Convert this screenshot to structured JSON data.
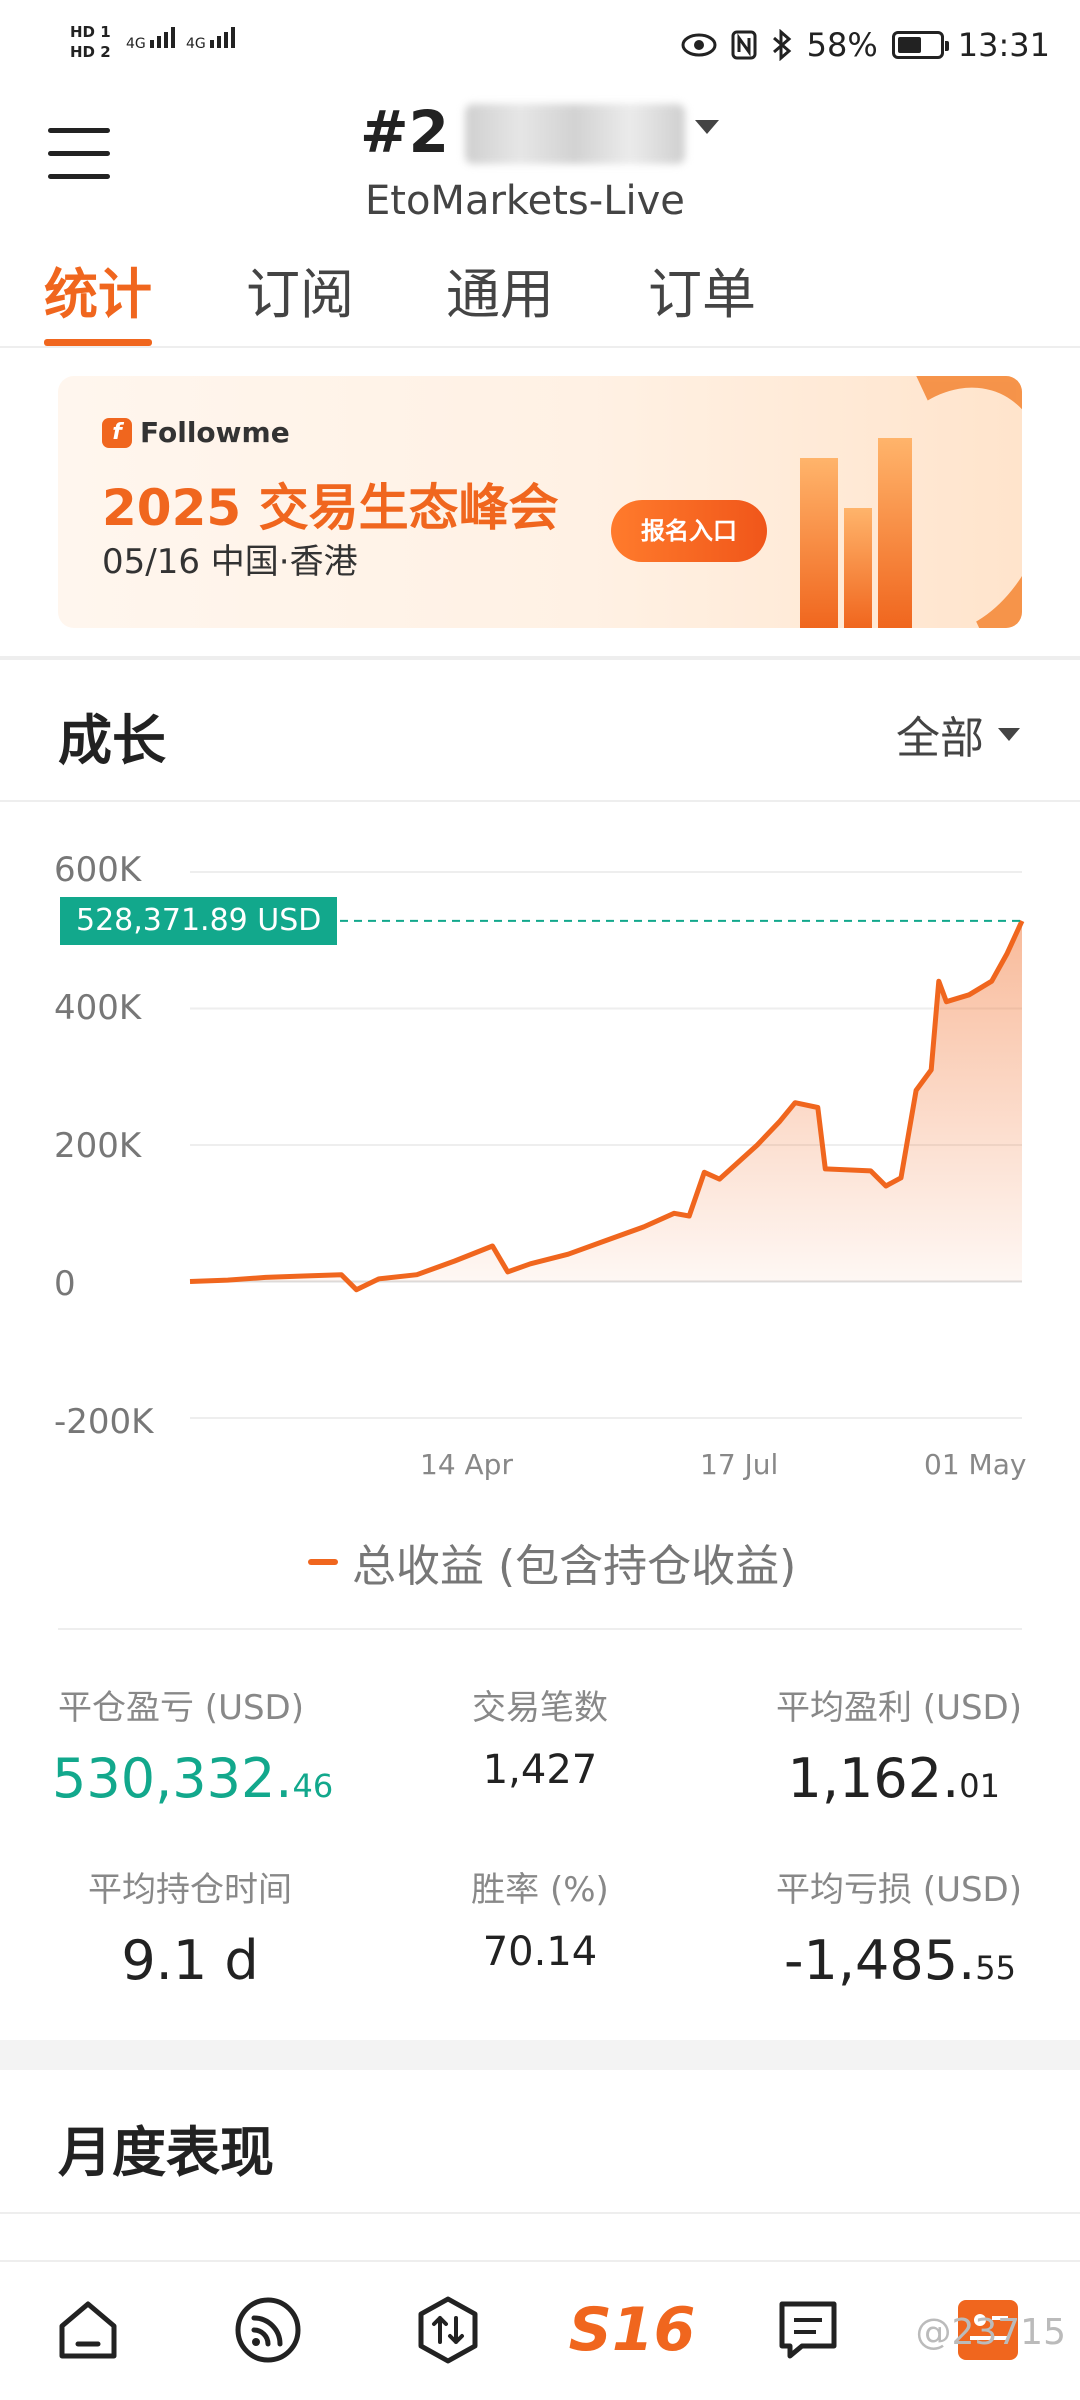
{
  "status_bar": {
    "hd1": "HD 1",
    "hd2": "HD 2",
    "net1": "4G",
    "net2": "4G",
    "battery_pct": "58%",
    "battery_level": 0.58,
    "time": "13:31",
    "icons": [
      "eye-icon",
      "nfc-icon",
      "bluetooth-icon"
    ]
  },
  "header": {
    "account_prefix": "#2",
    "server": "EtoMarkets-Live"
  },
  "tabs": [
    {
      "label": "统计",
      "active": true
    },
    {
      "label": "订阅",
      "active": false
    },
    {
      "label": "通用",
      "active": false
    },
    {
      "label": "订单",
      "active": false
    }
  ],
  "banner": {
    "brand": "Followme",
    "title": "2025 交易生态峰会",
    "subtitle": "05/16 中国·香港",
    "button": "报名入口"
  },
  "growth": {
    "title": "成长",
    "filter": "全部",
    "current_value": "528,371.89 USD",
    "legend": "总收益 (包含持仓收益)"
  },
  "chart_data": {
    "type": "area",
    "series": [
      {
        "name": "总收益 (包含持仓收益)",
        "color": "#f0661e",
        "points": [
          [
            0,
            0
          ],
          [
            0.05,
            2000
          ],
          [
            0.1,
            6000
          ],
          [
            0.15,
            8000
          ],
          [
            0.2,
            10000
          ],
          [
            0.22,
            -12000
          ],
          [
            0.25,
            4000
          ],
          [
            0.3,
            10000
          ],
          [
            0.35,
            30000
          ],
          [
            0.4,
            52000
          ],
          [
            0.42,
            14000
          ],
          [
            0.45,
            26000
          ],
          [
            0.5,
            40000
          ],
          [
            0.55,
            60000
          ],
          [
            0.6,
            80000
          ],
          [
            0.64,
            100000
          ],
          [
            0.66,
            96000
          ],
          [
            0.68,
            160000
          ],
          [
            0.7,
            150000
          ],
          [
            0.72,
            170000
          ],
          [
            0.75,
            200000
          ],
          [
            0.78,
            235000
          ],
          [
            0.8,
            262000
          ],
          [
            0.83,
            255000
          ],
          [
            0.84,
            165000
          ],
          [
            0.9,
            162000
          ],
          [
            0.92,
            140000
          ],
          [
            0.94,
            152000
          ],
          [
            0.96,
            280000
          ],
          [
            0.98,
            310000
          ],
          [
            0.99,
            440000
          ],
          [
            1.0,
            410000
          ],
          [
            1.03,
            420000
          ],
          [
            1.06,
            440000
          ],
          [
            1.08,
            480000
          ],
          [
            1.1,
            528371.89
          ]
        ]
      }
    ],
    "ylim": [
      -200000,
      600000
    ],
    "yticks": [
      "600K",
      "400K",
      "200K",
      "0",
      "-200K"
    ],
    "xticks": [
      "14 Apr",
      "17 Jul",
      "01 May"
    ],
    "current_value_label": "528,371.89 USD",
    "grid": true
  },
  "stats": {
    "closed_pnl_label": "平仓盈亏 (USD)",
    "closed_pnl_int": "530,332.",
    "closed_pnl_dec": "46",
    "trades_label": "交易笔数",
    "trades": "1,427",
    "avg_profit_label": "平均盈利 (USD)",
    "avg_profit_int": "1,162.",
    "avg_profit_dec": "01",
    "avg_hold_label": "平均持仓时间",
    "avg_hold": "9.1 d",
    "win_rate_label": "胜率 (%)",
    "win_rate": "70.14",
    "avg_loss_label": "平均亏损 (USD)",
    "avg_loss_int": "-1,485.",
    "avg_loss_dec": "55"
  },
  "monthly": {
    "title": "月度表现"
  },
  "bottom_nav": [
    {
      "icon": "home-icon",
      "active": false
    },
    {
      "icon": "feed-icon",
      "active": false
    },
    {
      "icon": "trade-icon",
      "active": false
    },
    {
      "icon": "s16-icon",
      "label": "S16",
      "active": true
    },
    {
      "icon": "message-icon",
      "active": false
    },
    {
      "icon": "profile-icon",
      "active": false
    }
  ],
  "watermark": "@23715"
}
